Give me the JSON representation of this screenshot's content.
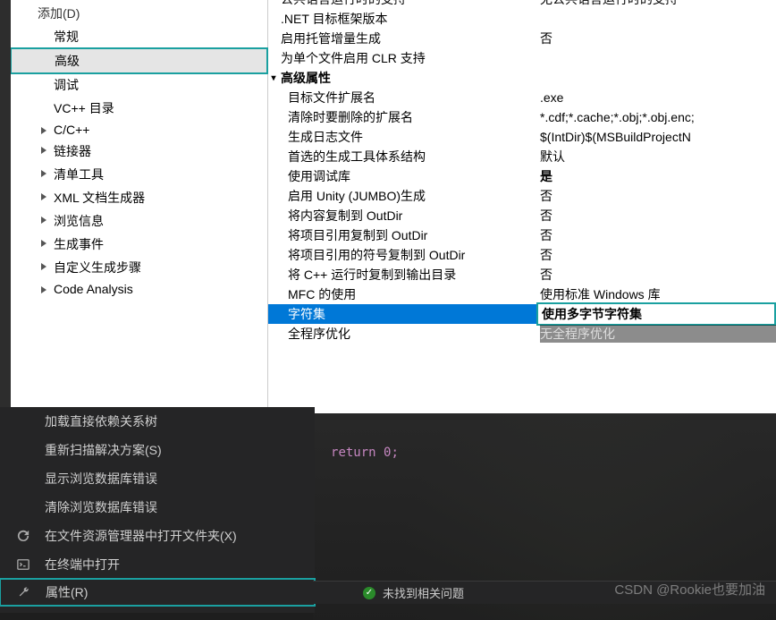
{
  "tree": {
    "top": "添加(D)",
    "items": [
      {
        "label": "常规",
        "chev": false
      },
      {
        "label": "高级",
        "chev": false,
        "selected": true
      },
      {
        "label": "调试",
        "chev": false
      },
      {
        "label": "VC++ 目录",
        "chev": false
      },
      {
        "label": "C/C++",
        "chev": true
      },
      {
        "label": "链接器",
        "chev": true
      },
      {
        "label": "清单工具",
        "chev": true
      },
      {
        "label": "XML 文档生成器",
        "chev": true
      },
      {
        "label": "浏览信息",
        "chev": true
      },
      {
        "label": "生成事件",
        "chev": true
      },
      {
        "label": "自定义生成步骤",
        "chev": true
      },
      {
        "label": "Code Analysis",
        "chev": true
      }
    ]
  },
  "grid": {
    "rows": [
      {
        "k": "公共语言运行时的支持",
        "v": "无公共语言运行时的支持",
        "cut": true
      },
      {
        "k": ".NET 目标框架版本",
        "v": ""
      },
      {
        "k": "启用托管增量生成",
        "v": "否"
      },
      {
        "k": "为单个文件启用 CLR 支持",
        "v": ""
      }
    ],
    "section": "高级属性",
    "adv": [
      {
        "k": "目标文件扩展名",
        "v": ".exe"
      },
      {
        "k": "清除时要删除的扩展名",
        "v": "*.cdf;*.cache;*.obj;*.obj.enc;"
      },
      {
        "k": "生成日志文件",
        "v": "$(IntDir)$(MSBuildProjectN"
      },
      {
        "k": "首选的生成工具体系结构",
        "v": "默认"
      },
      {
        "k": "使用调试库",
        "v": "是",
        "bold": true
      },
      {
        "k": "启用 Unity (JUMBO)生成",
        "v": "否"
      },
      {
        "k": "将内容复制到 OutDir",
        "v": "否"
      },
      {
        "k": "将项目引用复制到 OutDir",
        "v": "否"
      },
      {
        "k": "将项目引用的符号复制到 OutDir",
        "v": "否"
      },
      {
        "k": "将 C++ 运行时复制到输出目录",
        "v": "否"
      },
      {
        "k": "MFC 的使用",
        "v": "使用标准 Windows 库"
      },
      {
        "k": "字符集",
        "v": "使用多字节字符集",
        "selected": true
      },
      {
        "k": "全程序优化",
        "v": "无全程序优化",
        "dark": true
      }
    ]
  },
  "context_menu": {
    "items": [
      {
        "label": "加载直接依赖关系树"
      },
      {
        "label": "重新扫描解决方案(S)"
      },
      {
        "label": "显示浏览数据库错误"
      },
      {
        "label": "清除浏览数据库错误"
      },
      {
        "label": "在文件资源管理器中打开文件夹(X)",
        "icon": "refresh"
      },
      {
        "label": "在终端中打开",
        "icon": "terminal"
      },
      {
        "label": "属性(R)",
        "icon": "wrench",
        "highlighted": true
      }
    ]
  },
  "code": {
    "line": "eturn 0;"
  },
  "status": {
    "text": "未找到相关问题"
  },
  "watermark": "CSDN @Rookie也要加油"
}
